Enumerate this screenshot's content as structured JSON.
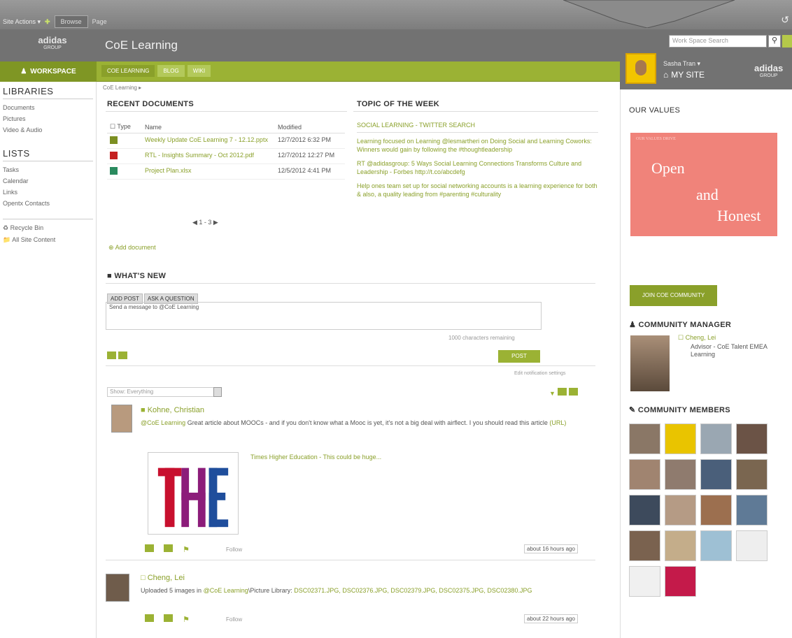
{
  "topbar": {
    "site_actions": "Site Actions ▾",
    "tab_browse": "Browse",
    "tab_page": "Page",
    "icons": "↺"
  },
  "header": {
    "brand_name": "adidas",
    "brand_sub": "GROUP",
    "site_title": "CoE Learning"
  },
  "greennav": {
    "workspace": "WORKSPACE",
    "tabs": [
      "COE LEARNING",
      "BLOG",
      "WIKI"
    ]
  },
  "right_top": {
    "search_placeholder": "Work Space Search",
    "user_name": "Sasha Tran ▾",
    "mysite": "MY SITE",
    "brand_name": "adidas",
    "brand_sub": "GROUP"
  },
  "leftnav": {
    "libraries_heading": "LIBRARIES",
    "libraries": [
      "Documents",
      "Pictures",
      "Video & Audio"
    ],
    "lists_heading": "LISTS",
    "lists": [
      "Tasks",
      "Calendar",
      "Links",
      "Opentx Contacts"
    ],
    "recycle": "Recycle Bin",
    "all_content": "All Site Content"
  },
  "center": {
    "breadcrumb": "CoE Learning ▸",
    "recent_docs_title": "RECENT DOCUMENTS",
    "docs_headers": [
      "Type",
      "Name",
      "Modified"
    ],
    "docs": [
      {
        "name": "Weekly Update CoE Learning 7 - 12.12.pptx",
        "modified": "12/7/2012 6:32 PM"
      },
      {
        "name": "RTL - Insights Summary - Oct 2012.pdf",
        "modified": "12/7/2012 12:27 PM"
      },
      {
        "name": "Project Plan.xlsx",
        "modified": "12/5/2012 4:41 PM"
      }
    ],
    "pager": "◀ 1 - 3 ▶",
    "add_doc": "Add document",
    "topic_title": "TOPIC OF THE WEEK",
    "topic_sub": "SOCIAL LEARNING - TWITTER SEARCH",
    "topic_items": [
      "Learning focused on Learning @lesmartheri on Doing Social and Learning Coworks: Winners would gain by following the #thoughtleadership",
      "RT @adidasgroup: 5 Ways Social Learning Connections Transforms Culture and Leadership - Forbes http://t.co/abcdefg",
      "Help ones team set up for social networking accounts is a learning experience for both & also, a quality leading from #parenting #culturality"
    ],
    "whats_new": "WHAT'S NEW",
    "post_tabs": [
      "ADD POST",
      "ASK A QUESTION"
    ],
    "post_placeholder": "Send a message to @CoE Learning",
    "char_left": "1000 characters remaining",
    "post_button": "POST",
    "notif": "Edit notification settings",
    "show_label": "Show: Everything",
    "feed": [
      {
        "name": "Kohne, Christian",
        "text_mention": "@CoE Learning",
        "text": " Great article about MOOCs - and if you don't know what a Mooc is yet, it's not a big deal with airflect. I you should read this article",
        "link": "(URL)",
        "attachment_caption": "Times Higher Education - This could be huge...",
        "time": "about 16 hours ago",
        "like": "Follow"
      },
      {
        "name": "Cheng, Lei",
        "text_pre": "Uploaded 5 images in ",
        "text_mention": "@CoE Learning",
        "text_mid": "\\Picture Library: ",
        "files": "DSC02371.JPG, DSC02376.JPG, DSC02379.JPG, DSC02375.JPG, DSC02380.JPG",
        "time": "about 22 hours ago",
        "like": "Follow"
      }
    ]
  },
  "right_body": {
    "values_title": "OUR VALUES",
    "values_small": "OUR VALUES DRIVE",
    "values_words": [
      "Open",
      "and",
      "Honest"
    ],
    "join_button": "JOIN COE COMMUNITY",
    "manager_heading": "COMMUNITY MANAGER",
    "manager_name": "Cheng, Lei",
    "manager_desc": "Advisor - CoE Talent EMEA Learning",
    "members_heading": "COMMUNITY MEMBERS"
  },
  "colors": {
    "accent_green": "#9bb234",
    "header_gray": "#727272",
    "values_pink": "#f0837a"
  }
}
